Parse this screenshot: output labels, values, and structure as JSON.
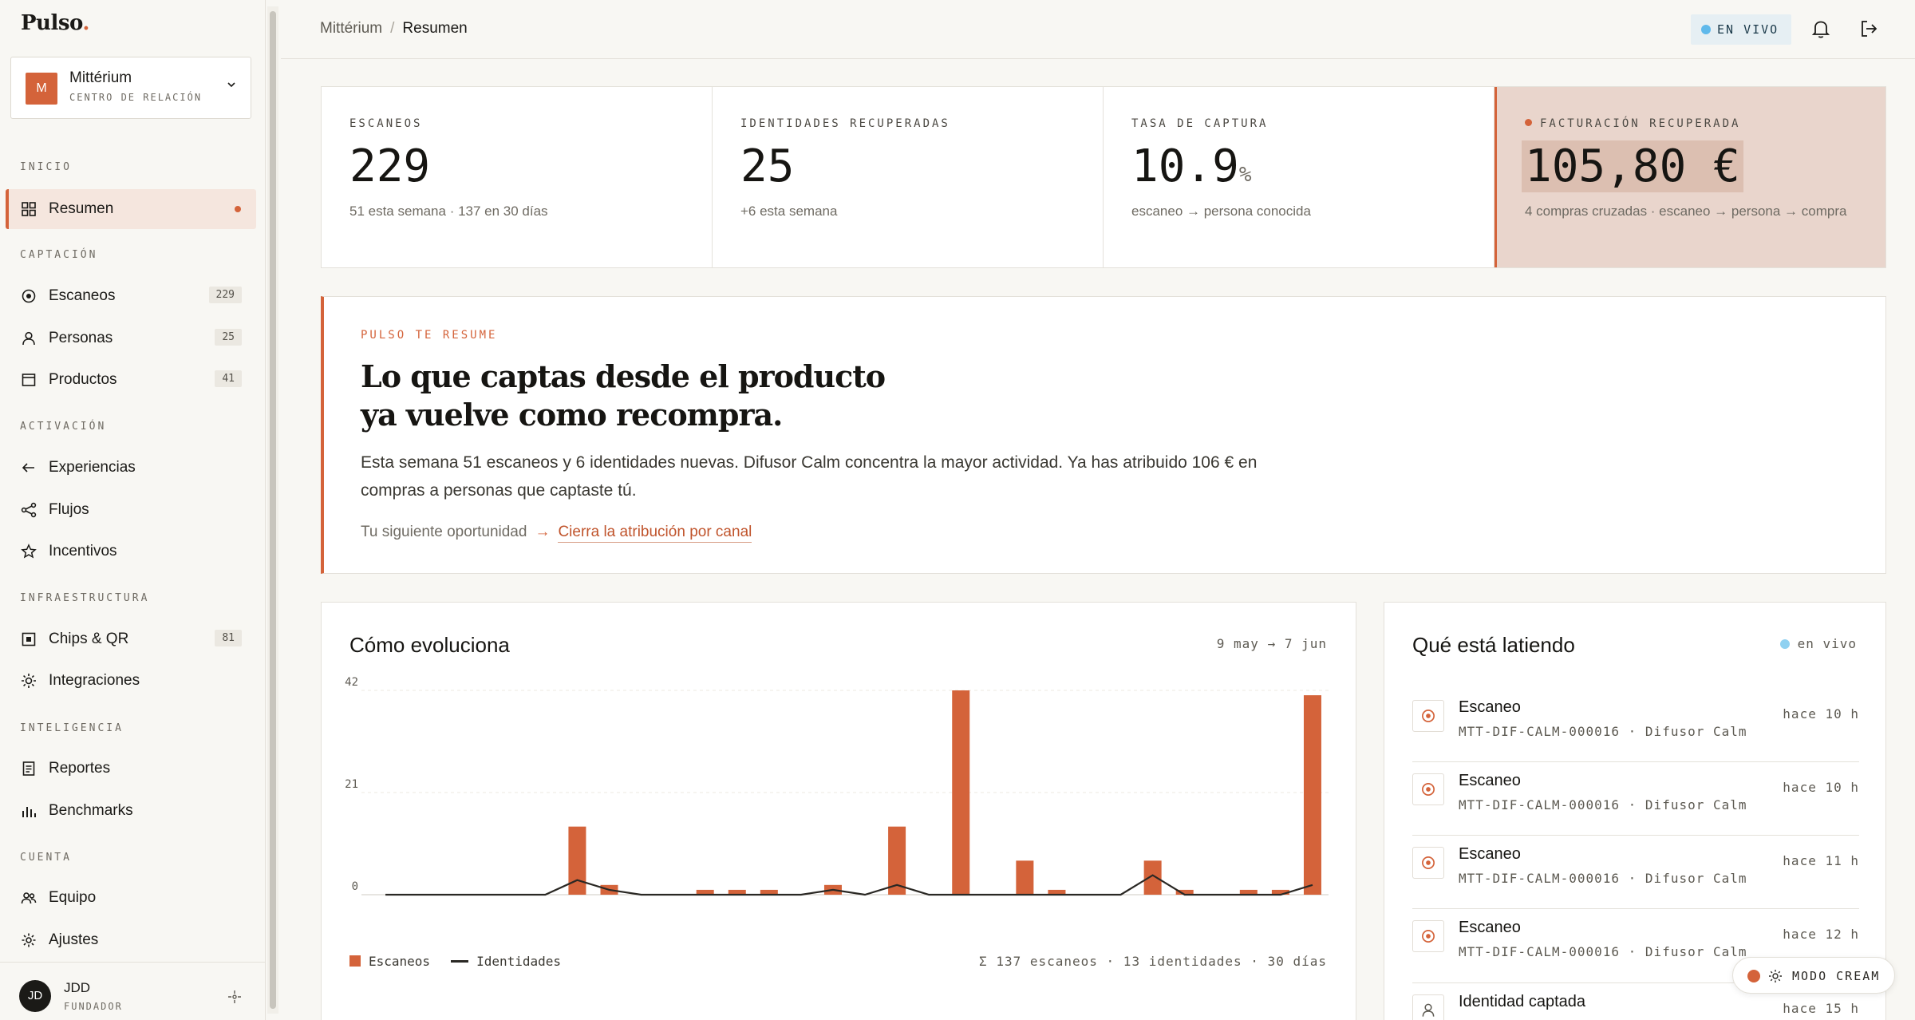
{
  "app": {
    "logo": "Pulso",
    "logo_dot": "."
  },
  "workspace": {
    "initial": "M",
    "name": "Mittérium",
    "subtitle": "CENTRO DE RELACIÓN"
  },
  "nav": {
    "sections": [
      {
        "title": "INICIO",
        "items": [
          {
            "label": "Resumen",
            "icon": "grid-icon",
            "active": true
          }
        ]
      },
      {
        "title": "CAPTACIÓN",
        "items": [
          {
            "label": "Escaneos",
            "icon": "target-icon",
            "count": "229"
          },
          {
            "label": "Personas",
            "icon": "person-icon",
            "count": "25"
          },
          {
            "label": "Productos",
            "icon": "box-icon",
            "count": "41"
          }
        ]
      },
      {
        "title": "ACTIVACIÓN",
        "items": [
          {
            "label": "Experiencias",
            "icon": "arrow-left-icon"
          },
          {
            "label": "Flujos",
            "icon": "share-icon"
          },
          {
            "label": "Incentivos",
            "icon": "star-icon"
          }
        ]
      },
      {
        "title": "INFRAESTRUCTURA",
        "items": [
          {
            "label": "Chips & QR",
            "icon": "chip-icon",
            "count": "81"
          },
          {
            "label": "Integraciones",
            "icon": "sun-icon"
          }
        ]
      },
      {
        "title": "INTELIGENCIA",
        "items": [
          {
            "label": "Reportes",
            "icon": "document-icon"
          },
          {
            "label": "Benchmarks",
            "icon": "bars-icon"
          }
        ]
      },
      {
        "title": "CUENTA",
        "items": [
          {
            "label": "Equipo",
            "icon": "team-icon"
          },
          {
            "label": "Ajustes",
            "icon": "gear-icon"
          }
        ]
      }
    ]
  },
  "user": {
    "initials": "JD",
    "name": "JDD",
    "role": "FUNDADOR"
  },
  "header": {
    "breadcrumb_parent": "Mittérium",
    "breadcrumb_sep": "/",
    "breadcrumb_current": "Resumen",
    "live_label": "EN VIVO"
  },
  "kpis": [
    {
      "label": "ESCANEOS",
      "value": "229",
      "unit": "",
      "sub": "51 esta semana · 137 en 30 días"
    },
    {
      "label": "IDENTIDADES RECUPERADAS",
      "value": "25",
      "unit": "",
      "sub": "+6 esta semana"
    },
    {
      "label": "TASA DE CAPTURA",
      "value": "10.9",
      "unit": "%",
      "sub": "escaneo → persona conocida"
    },
    {
      "label": "FACTURACIÓN RECUPERADA",
      "value": "105,80 €",
      "unit": "",
      "sub": "4 compras cruzadas · escaneo → persona → compra"
    }
  ],
  "summary": {
    "eyebrow": "PULSO TE RESUME",
    "title_line1": "Lo que captas desde el producto",
    "title_line2": "ya vuelve como recompra.",
    "body": "Esta semana 51 escaneos y 6 identidades nuevas. Difusor Calm concentra la mayor actividad. Ya has atribuido 106 € en compras a personas que captaste tú.",
    "next_label": "Tu siguiente oportunidad",
    "next_arrow": "→",
    "next_link": "Cierra la atribución por canal"
  },
  "chart_card": {
    "title": "Cómo evoluciona",
    "range": "9 may → 7 jun",
    "legend_scans": "Escaneos",
    "legend_identities": "Identidades",
    "total": "Σ 137 escaneos · 13 identidades · 30 días"
  },
  "chart_data": {
    "type": "bar",
    "x": [
      1,
      2,
      3,
      4,
      5,
      6,
      7,
      8,
      9,
      10,
      11,
      12,
      13,
      14,
      15,
      16,
      17,
      18,
      19,
      20,
      21,
      22,
      23,
      24,
      25,
      26,
      27,
      28,
      29,
      30
    ],
    "yticks": [
      "0",
      "21",
      "42"
    ],
    "ylim": [
      0,
      42
    ],
    "series": [
      {
        "name": "Escaneos",
        "type": "bar",
        "color": "#d4633a",
        "values": [
          0,
          0,
          0,
          0,
          0,
          0,
          14,
          2,
          0,
          0,
          1,
          1,
          1,
          0,
          2,
          0,
          14,
          0,
          42,
          0,
          7,
          1,
          0,
          0,
          7,
          1,
          0,
          1,
          1,
          41
        ]
      },
      {
        "name": "Identidades",
        "type": "line",
        "color": "#2a2824",
        "values": [
          0,
          0,
          0,
          0,
          0,
          0,
          3,
          1,
          0,
          0,
          0,
          0,
          0,
          0,
          1,
          0,
          2,
          0,
          0,
          0,
          0,
          0,
          0,
          0,
          4,
          0,
          0,
          0,
          0,
          2
        ]
      }
    ]
  },
  "activity": {
    "title": "Qué está latiendo",
    "live": "en vivo",
    "items": [
      {
        "title": "Escaneo",
        "sub": "MTT-DIF-CALM-000016 · Difusor Calm",
        "time": "hace 10 h",
        "icon": "target-icon"
      },
      {
        "title": "Escaneo",
        "sub": "MTT-DIF-CALM-000016 · Difusor Calm",
        "time": "hace 10 h",
        "icon": "target-icon"
      },
      {
        "title": "Escaneo",
        "sub": "MTT-DIF-CALM-000016 · Difusor Calm",
        "time": "hace 11 h",
        "icon": "target-icon"
      },
      {
        "title": "Escaneo",
        "sub": "MTT-DIF-CALM-000016 · Difusor Calm",
        "time": "hace 12 h",
        "icon": "target-icon"
      },
      {
        "title": "Identidad captada",
        "sub": "",
        "time": "hace 15 h",
        "icon": "person-icon"
      }
    ]
  },
  "mode_toggle": {
    "label": "MODO CREAM"
  },
  "colors": {
    "accent": "#d4633a",
    "live": "#5fb9eb",
    "ink": "#1b1a17"
  }
}
